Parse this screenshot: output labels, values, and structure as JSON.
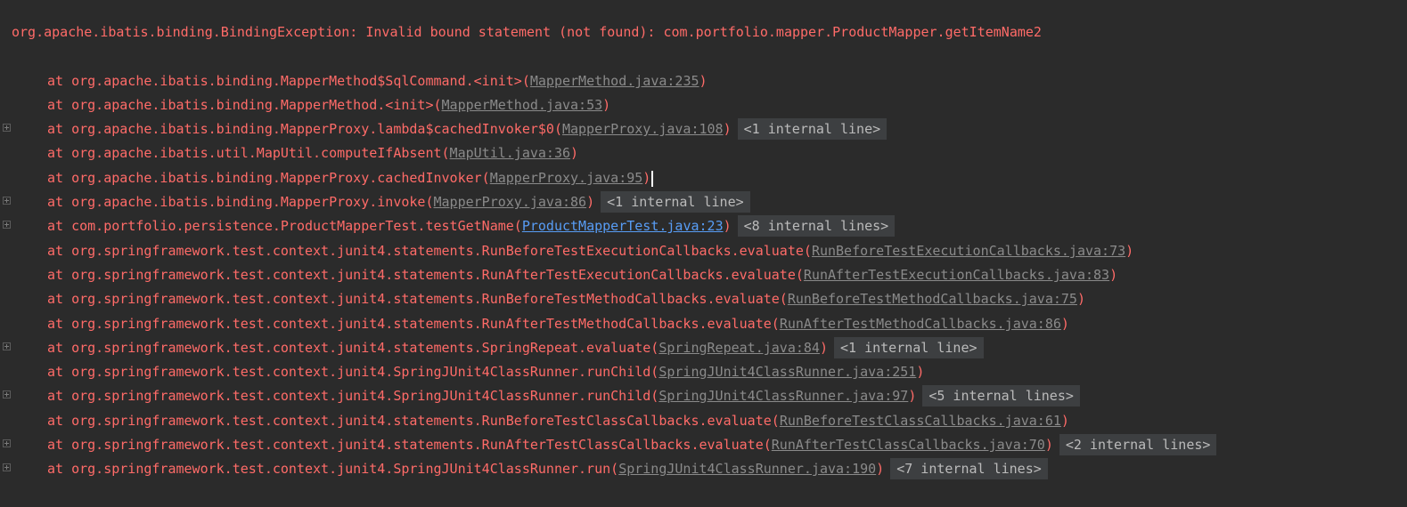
{
  "console": {
    "exception_line": "org.apache.ibatis.binding.BindingException: Invalid bound statement (not found): com.portfolio.mapper.ProductMapper.getItemName2",
    "frames": [
      {
        "text": "at org.apache.ibatis.binding.MapperMethod$SqlCommand.<init>(",
        "link": "MapperMethod.java:235",
        "internal": ""
      },
      {
        "text": "at org.apache.ibatis.binding.MapperMethod.<init>(",
        "link": "MapperMethod.java:53",
        "internal": ""
      },
      {
        "text": "at org.apache.ibatis.binding.MapperProxy.lambda$cachedInvoker$0(",
        "link": "MapperProxy.java:108",
        "internal": "<1 internal line>"
      },
      {
        "text": "at org.apache.ibatis.util.MapUtil.computeIfAbsent(",
        "link": "MapUtil.java:36",
        "internal": ""
      },
      {
        "text": "at org.apache.ibatis.binding.MapperProxy.cachedInvoker(",
        "link": "MapperProxy.java:95",
        "internal": ""
      },
      {
        "text": "at org.apache.ibatis.binding.MapperProxy.invoke(",
        "link": "MapperProxy.java:86",
        "internal": "<1 internal line>"
      },
      {
        "text": "at com.portfolio.persistence.ProductMapperTest.testGetName(",
        "link": "ProductMapperTest.java:23",
        "internal": "<8 internal lines>"
      },
      {
        "text": "at org.springframework.test.context.junit4.statements.RunBeforeTestExecutionCallbacks.evaluate(",
        "link": "RunBeforeTestExecutionCallbacks.java:73",
        "internal": ""
      },
      {
        "text": "at org.springframework.test.context.junit4.statements.RunAfterTestExecutionCallbacks.evaluate(",
        "link": "RunAfterTestExecutionCallbacks.java:83",
        "internal": ""
      },
      {
        "text": "at org.springframework.test.context.junit4.statements.RunBeforeTestMethodCallbacks.evaluate(",
        "link": "RunBeforeTestMethodCallbacks.java:75",
        "internal": ""
      },
      {
        "text": "at org.springframework.test.context.junit4.statements.RunAfterTestMethodCallbacks.evaluate(",
        "link": "RunAfterTestMethodCallbacks.java:86",
        "internal": ""
      },
      {
        "text": "at org.springframework.test.context.junit4.statements.SpringRepeat.evaluate(",
        "link": "SpringRepeat.java:84",
        "internal": "<1 internal line>"
      },
      {
        "text": "at org.springframework.test.context.junit4.SpringJUnit4ClassRunner.runChild(",
        "link": "SpringJUnit4ClassRunner.java:251",
        "internal": ""
      },
      {
        "text": "at org.springframework.test.context.junit4.SpringJUnit4ClassRunner.runChild(",
        "link": "SpringJUnit4ClassRunner.java:97",
        "internal": "<5 internal lines>"
      },
      {
        "text": "at org.springframework.test.context.junit4.statements.RunBeforeTestClassCallbacks.evaluate(",
        "link": "RunBeforeTestClassCallbacks.java:61",
        "internal": ""
      },
      {
        "text": "at org.springframework.test.context.junit4.statements.RunAfterTestClassCallbacks.evaluate(",
        "link": "RunAfterTestClassCallbacks.java:70",
        "internal": "<2 internal lines>"
      },
      {
        "text": "at org.springframework.test.context.junit4.SpringJUnit4ClassRunner.run(",
        "link": "SpringJUnit4ClassRunner.java:190",
        "internal": "<7 internal lines>"
      }
    ],
    "close_paren": ")"
  },
  "colors": {
    "background": "#2b2b2b",
    "error_text": "#ff6b68",
    "link": "#8a8a8a",
    "active_link": "#589df6",
    "internal_bg": "#3d3f41"
  },
  "icons": {
    "fold": "expand-fold-icon"
  }
}
